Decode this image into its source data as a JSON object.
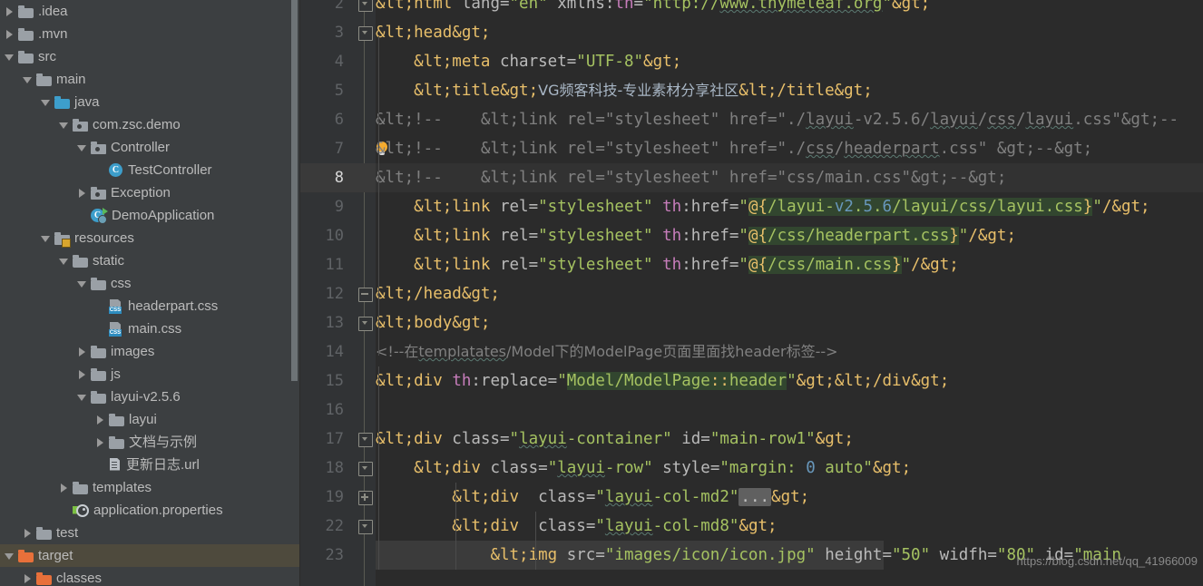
{
  "project_tree": {
    "items": [
      {
        "label": ".idea",
        "indent": 0,
        "twisty": "right",
        "icon": "folder-icon",
        "selected": false
      },
      {
        "label": ".mvn",
        "indent": 0,
        "twisty": "right",
        "icon": "folder-icon",
        "selected": false
      },
      {
        "label": "src",
        "indent": 0,
        "twisty": "down",
        "icon": "folder-icon",
        "selected": false
      },
      {
        "label": "main",
        "indent": 1,
        "twisty": "down",
        "icon": "folder-icon",
        "selected": false
      },
      {
        "label": "java",
        "indent": 2,
        "twisty": "down",
        "icon": "source-folder-icon",
        "selected": false
      },
      {
        "label": "com.zsc.demo",
        "indent": 3,
        "twisty": "down",
        "icon": "package-icon",
        "selected": false
      },
      {
        "label": "Controller",
        "indent": 4,
        "twisty": "down",
        "icon": "package-icon",
        "selected": false
      },
      {
        "label": "TestController",
        "indent": 5,
        "twisty": "none",
        "icon": "java-class-icon",
        "selected": false
      },
      {
        "label": "Exception",
        "indent": 4,
        "twisty": "right",
        "icon": "package-icon",
        "selected": false
      },
      {
        "label": "DemoApplication",
        "indent": 4,
        "twisty": "none",
        "icon": "spring-boot-app-icon",
        "selected": false
      },
      {
        "label": "resources",
        "indent": 2,
        "twisty": "down",
        "icon": "resources-folder-icon",
        "selected": false
      },
      {
        "label": "static",
        "indent": 3,
        "twisty": "down",
        "icon": "folder-icon",
        "selected": false
      },
      {
        "label": "css",
        "indent": 4,
        "twisty": "down",
        "icon": "folder-icon",
        "selected": false
      },
      {
        "label": "headerpart.css",
        "indent": 5,
        "twisty": "none",
        "icon": "css-file-icon",
        "selected": false
      },
      {
        "label": "main.css",
        "indent": 5,
        "twisty": "none",
        "icon": "css-file-icon",
        "selected": false
      },
      {
        "label": "images",
        "indent": 4,
        "twisty": "right",
        "icon": "folder-icon",
        "selected": false
      },
      {
        "label": "js",
        "indent": 4,
        "twisty": "right",
        "icon": "folder-icon",
        "selected": false
      },
      {
        "label": "layui-v2.5.6",
        "indent": 4,
        "twisty": "down",
        "icon": "folder-icon",
        "selected": false
      },
      {
        "label": "layui",
        "indent": 5,
        "twisty": "right",
        "icon": "folder-icon",
        "selected": false
      },
      {
        "label": "文档与示例",
        "indent": 5,
        "twisty": "right",
        "icon": "folder-icon",
        "selected": false
      },
      {
        "label": "更新日志.url",
        "indent": 5,
        "twisty": "none",
        "icon": "url-file-icon",
        "selected": false
      },
      {
        "label": "templates",
        "indent": 3,
        "twisty": "right",
        "icon": "folder-icon",
        "selected": false
      },
      {
        "label": "application.properties",
        "indent": 3,
        "twisty": "none",
        "icon": "properties-file-icon",
        "selected": false
      },
      {
        "label": "test",
        "indent": 1,
        "twisty": "right",
        "icon": "folder-icon",
        "selected": false
      },
      {
        "label": "target",
        "indent": 0,
        "twisty": "down",
        "icon": "folder-icon-orange",
        "selected": true
      },
      {
        "label": "classes",
        "indent": 1,
        "twisty": "right",
        "icon": "folder-icon-orange",
        "selected": false
      }
    ]
  },
  "editor": {
    "active_line": 8,
    "watermark": "https://blog.csdn.net/qq_41966009",
    "line_numbers": [
      2,
      3,
      4,
      5,
      6,
      7,
      8,
      9,
      10,
      11,
      12,
      13,
      14,
      15,
      16,
      17,
      18,
      19,
      22,
      23
    ],
    "lines": [
      {
        "num": 2,
        "text": "<html lang=\"en\" xmlns:th=\"http://www.thymeleaf.org\">"
      },
      {
        "num": 3,
        "text": "<head>"
      },
      {
        "num": 4,
        "text": "    <meta charset=\"UTF-8\">"
      },
      {
        "num": 5,
        "text": "    <title>VG频客科技-专业素材分享社区</title>"
      },
      {
        "num": 6,
        "text": "<!--    <link rel=\"stylesheet\" href=\"./layui-v2.5.6/layui/css/layui.css\">--"
      },
      {
        "num": 7,
        "text": "<!--    <link rel=\"stylesheet\" href=\"./css/headerpart.css\" >-->"
      },
      {
        "num": 8,
        "text": "<!--    <link rel=\"stylesheet\" href=\"css/main.css\">-->"
      },
      {
        "num": 9,
        "text": "    <link rel=\"stylesheet\" th:href=\"@{/layui-v2.5.6/layui/css/layui.css}\"/>"
      },
      {
        "num": 10,
        "text": "    <link rel=\"stylesheet\" th:href=\"@{/css/headerpart.css}\"/>"
      },
      {
        "num": 11,
        "text": "    <link rel=\"stylesheet\" th:href=\"@{/css/main.css}\"/>"
      },
      {
        "num": 12,
        "text": "</head>"
      },
      {
        "num": 13,
        "text": "<body>"
      },
      {
        "num": 14,
        "text": "<!--在templatates/Model下的ModelPage页面里面找header标签-->"
      },
      {
        "num": 15,
        "text": "<div th:replace=\"Model/ModelPage::header\"></div>"
      },
      {
        "num": 16,
        "text": ""
      },
      {
        "num": 17,
        "text": "<div class=\"layui-container\" id=\"main-row1\">"
      },
      {
        "num": 18,
        "text": "    <div class=\"layui-row\" style=\"margin: 0 auto\">"
      },
      {
        "num": 19,
        "text": "        <div  class=\"layui-col-md2\"...>"
      },
      {
        "num": 22,
        "text": "        <div  class=\"layui-col-md8\">"
      },
      {
        "num": 23,
        "text": "            <img src=\"images/icon/icon.jpg\" height=\"50\" widfh=\"80\" id=\"main"
      }
    ],
    "line5_title_text": "VG频客科技-专业素材分享社区",
    "line14_comment_text": "<!--在templatates/Model下的ModelPage页面里面找header标签-->",
    "thymeleaf_expressions": [
      "@{/layui-v2.5.6/layui/css/layui.css}",
      "@{/css/headerpart.css}",
      "@{/css/main.css}",
      "Model/ModelPage::header"
    ],
    "fold_placeholder": "..."
  },
  "colors": {
    "editor_bg": "#2b2b2b",
    "gutter_bg": "#313335",
    "panel_bg": "#3c3f41",
    "tag": "#e8bf6a",
    "attr": "#bababa",
    "attr_namespace": "#c77dbb",
    "string": "#a5c261",
    "comment": "#808080",
    "text": "#a9b7c6",
    "number": "#6897bb",
    "thymeleaf_bg": "#32462f",
    "selection_row": "#4e4a3d",
    "active_line": "#323232",
    "folder_orange": "#e8703a"
  }
}
